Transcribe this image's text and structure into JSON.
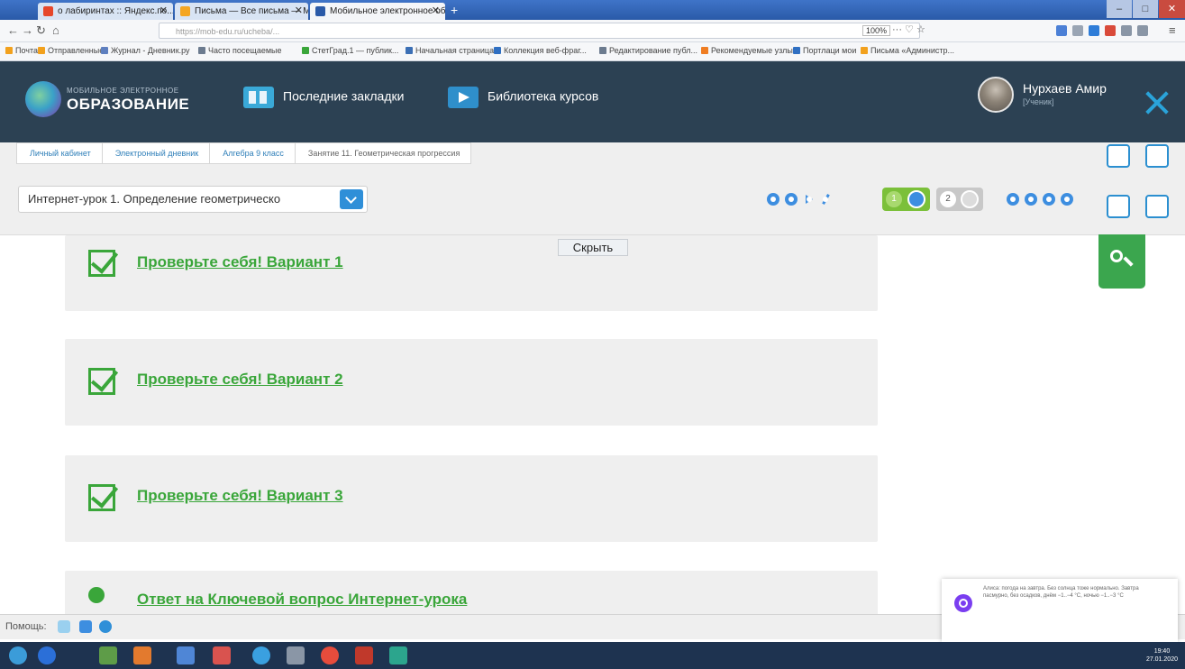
{
  "browser": {
    "tabs": [
      {
        "label": "о лабиринтах :: Яндекс.по...",
        "color": "#e6472b"
      },
      {
        "label": "Письма — Все письма — Mо...",
        "color": "#f4a623"
      },
      {
        "label": "Мобильное электронное обр...",
        "color": "#2a5aa8"
      }
    ],
    "address": "https://mob-edu.ru/ucheba/...",
    "zoom": "100%",
    "bookmarks": [
      "Почта",
      "Отправленные",
      "Журнал - Дневник.ру",
      "Часто посещаемые",
      "СтетГрад.1 — публик...",
      "Начальная страница",
      "Коллекция веб-фраг...",
      "Редактирование публ...",
      "Рекомендуемые узлы",
      "Портлаци мои",
      "Письма «Администр..."
    ]
  },
  "header": {
    "logo_small": "МОБИЛЬНОЕ ЭЛЕКТРОННОЕ",
    "logo_big": "ОБРАЗОВАНИЕ",
    "bookmarks_label": "Последние закладки",
    "library_label": "Библиотека курсов",
    "user_name": "Нурхаев Амир",
    "user_role": "[Ученик]"
  },
  "breadcrumb": [
    "Личный кабинет",
    "Электронный дневник",
    "Алгебра 9 класс",
    "Занятие 11. Геометрическая прогрессия"
  ],
  "lesson_select": "Интернет-урок 1. Определение геометрическо",
  "steps": [
    "1",
    "2"
  ],
  "hide_label": "Скрыть",
  "cards": [
    {
      "title": "Проверьте себя! Вариант 1"
    },
    {
      "title": "Проверьте себя! Вариант 2"
    },
    {
      "title": "Проверьте себя! Вариант 3"
    },
    {
      "title": "Ответ на Ключевой вопрос Интернет-урока"
    }
  ],
  "help_label": "Помощь:",
  "notification": "Алиса: погода на завтра. Без солнца тоже нормально. Завтра пасмурно, без осадков, днём −1..−4 °C, ночью −1..−3 °C",
  "clock": {
    "time": "19:40",
    "date": "27.01.2020"
  },
  "colors": {
    "header_bg": "#2c4153",
    "accent_green": "#3aa63a",
    "accent_blue": "#2f8fd8"
  }
}
